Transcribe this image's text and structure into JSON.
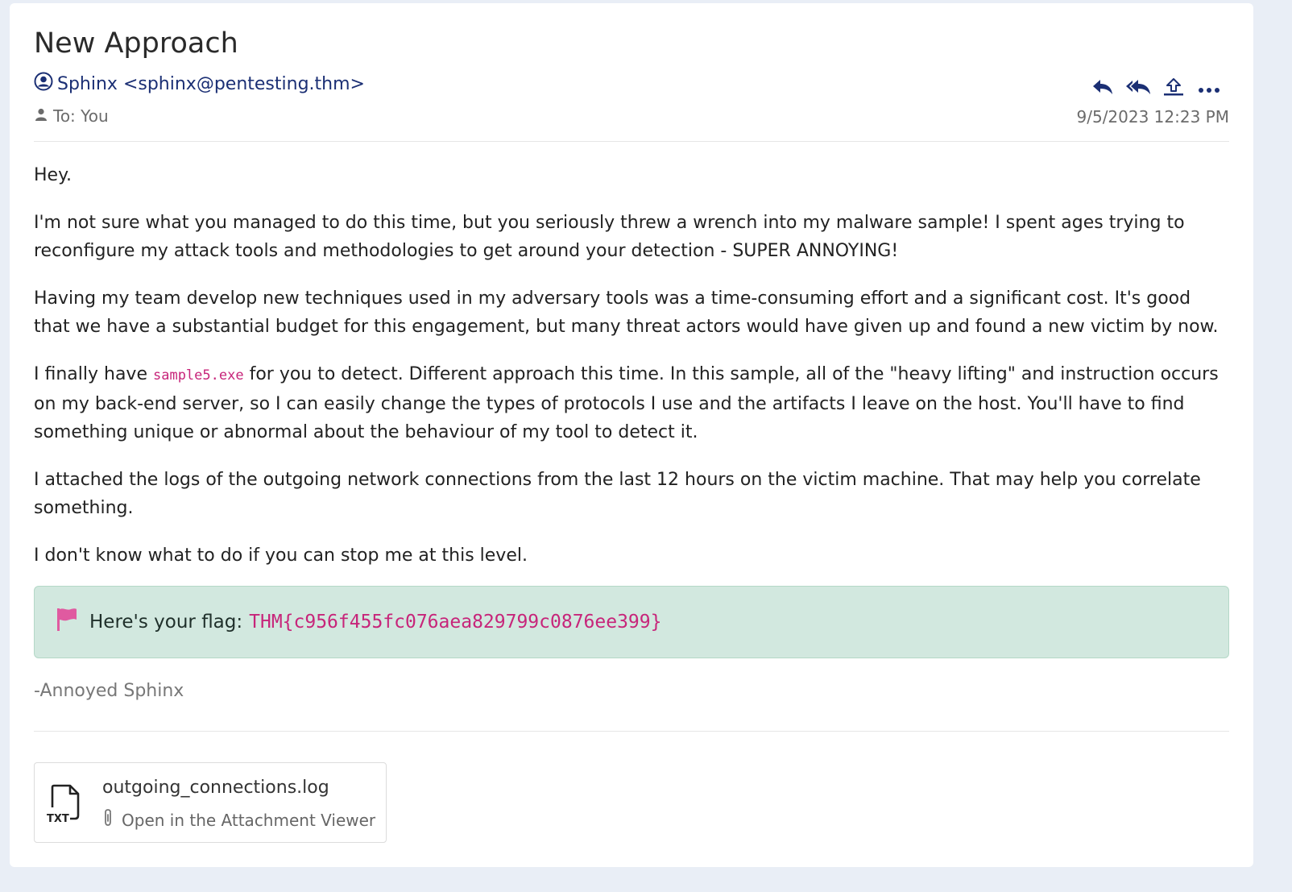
{
  "email": {
    "subject": "New Approach",
    "from": "Sphinx <sphinx@pentesting.thm>",
    "to": "To: You",
    "date": "9/5/2023 12:23 PM"
  },
  "actions": [
    {
      "name": "reply-button",
      "icon": "reply-icon"
    },
    {
      "name": "reply-all-button",
      "icon": "reply-all-icon"
    },
    {
      "name": "forward-button",
      "icon": "upload-icon"
    },
    {
      "name": "more-button",
      "icon": "ellipsis-icon"
    }
  ],
  "body": {
    "greeting": "Hey.",
    "p1": "I'm not sure what you managed to do this time, but you seriously threw a wrench into my malware sample! I spent ages trying to reconfigure my attack tools and methodologies to get around your detection - SUPER ANNOYING!",
    "p2": "Having my team develop new techniques used in my adversary tools was a time-consuming effort and a significant cost. It's good that we have a substantial budget for this engagement, but many threat actors would have given up and found a new victim by now.",
    "p3_before": "I finally have ",
    "p3_code": "sample5.exe",
    "p3_after": " for you to detect. Different approach this time. In this sample, all of the \"heavy lifting\" and instruction occurs on my back-end server, so I can easily change the types of protocols I use and the artifacts I leave on the host. You'll have to find something unique or abnormal about the behaviour of my tool to detect it.",
    "p4": "I attached the logs of the outgoing network connections from the last 12 hours on the victim machine. That may help you correlate something.",
    "p5": "I don't know what to do if you can stop me at this level."
  },
  "flag": {
    "label": "Here's your flag:",
    "value": "THM{c956f455fc076aea829799c0876ee399}"
  },
  "signature": "-Annoyed Sphinx",
  "attachment": {
    "filename": "outgoing_connections.log",
    "type_label": "TXT",
    "open_label": "Open in the Attachment Viewer"
  },
  "colors": {
    "sender": "#1b2f74",
    "code": "#c7257a",
    "flag_bg": "#d2e8df",
    "flag_icon": "#e05aa0"
  }
}
